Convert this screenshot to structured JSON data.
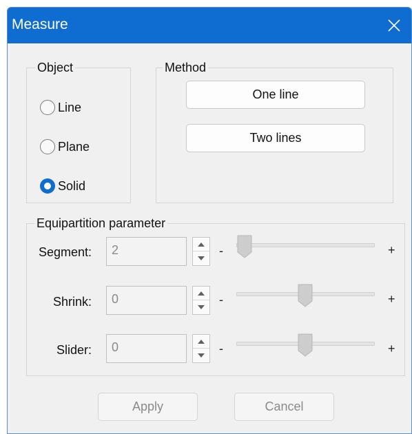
{
  "window": {
    "title": "Measure"
  },
  "object_group": {
    "legend": "Object",
    "options": [
      {
        "label": "Line",
        "checked": false
      },
      {
        "label": "Plane",
        "checked": false
      },
      {
        "label": "Solid",
        "checked": true
      }
    ]
  },
  "method_group": {
    "legend": "Method",
    "one_line_label": "One line",
    "two_lines_label": "Two lines"
  },
  "equipartition_group": {
    "legend": "Equipartition parameter",
    "segment": {
      "label": "Segment:",
      "value": "2",
      "minus": "-",
      "plus": "+"
    },
    "shrink": {
      "label": "Shrink:",
      "value": "0",
      "minus": "-",
      "plus": "+"
    },
    "slider": {
      "label": "Slider:",
      "value": "0",
      "minus": "-",
      "plus": "+"
    }
  },
  "footer": {
    "apply_label": "Apply",
    "cancel_label": "Cancel"
  },
  "colors": {
    "accent": "#0F6CD0",
    "disabled_text": "#8A8A8A"
  },
  "icons": {
    "close": "close-icon",
    "spin_up": "up-arrow-icon",
    "spin_down": "down-arrow-icon"
  }
}
